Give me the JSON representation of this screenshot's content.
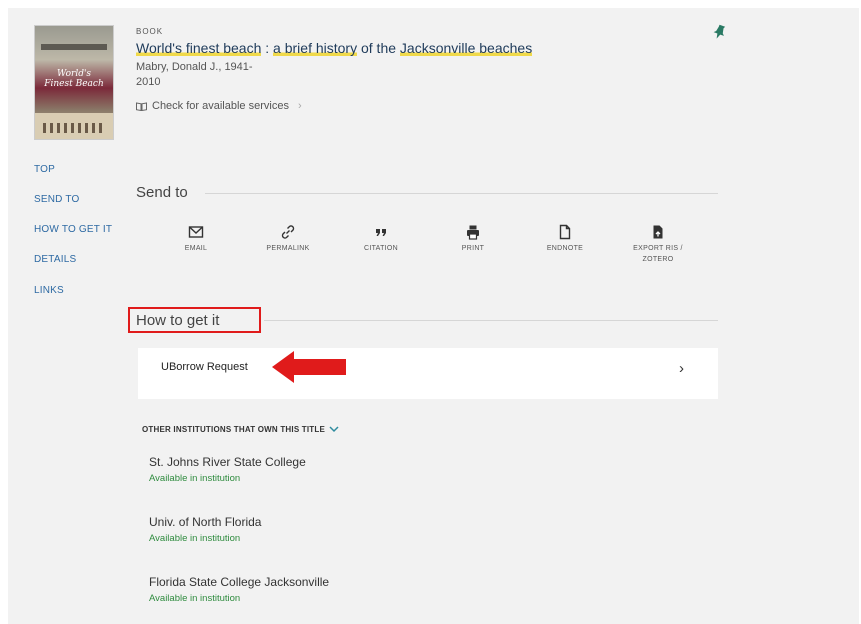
{
  "record": {
    "type": "BOOK",
    "title_part1": "World's finest beach",
    "title_sep": " : ",
    "title_part2": "a brief history",
    "title_of": " of the ",
    "title_part3": "Jacksonville beaches",
    "author": "Mabry, Donald J., 1941-",
    "year": "2010",
    "availability": "Check for available services",
    "cover_line1": "World's",
    "cover_line2": "Finest Beach"
  },
  "nav": {
    "top": "TOP",
    "send_to": "SEND TO",
    "how_to_get_it": "HOW TO GET IT",
    "details": "DETAILS",
    "links": "LINKS"
  },
  "send_to": {
    "heading": "Send to",
    "items": [
      {
        "label": "EMAIL",
        "icon": "email-icon"
      },
      {
        "label": "PERMALINK",
        "icon": "link-icon"
      },
      {
        "label": "CITATION",
        "icon": "quote-icon"
      },
      {
        "label": "PRINT",
        "icon": "printer-icon"
      },
      {
        "label": "ENDNOTE",
        "icon": "document-icon"
      },
      {
        "label": "EXPORT RIS /",
        "label2": "ZOTERO",
        "icon": "export-document-icon"
      }
    ]
  },
  "how_to_get_it": {
    "heading": "How to get it",
    "uborrow_label": "UBorrow Request",
    "other_institutions_label": "OTHER INSTITUTIONS THAT OWN THIS TITLE",
    "institutions": [
      {
        "name": "St. Johns River State College",
        "status": "Available in institution"
      },
      {
        "name": "Univ. of North Florida",
        "status": "Available in institution"
      },
      {
        "name": "Florida State College Jacksonville",
        "status": "Available in institution"
      }
    ]
  },
  "colors": {
    "accent_link": "#2e6aa3",
    "available_green": "#2e8b3e",
    "highlight_red": "#e01b1b",
    "pin_teal": "#2a7a64"
  }
}
